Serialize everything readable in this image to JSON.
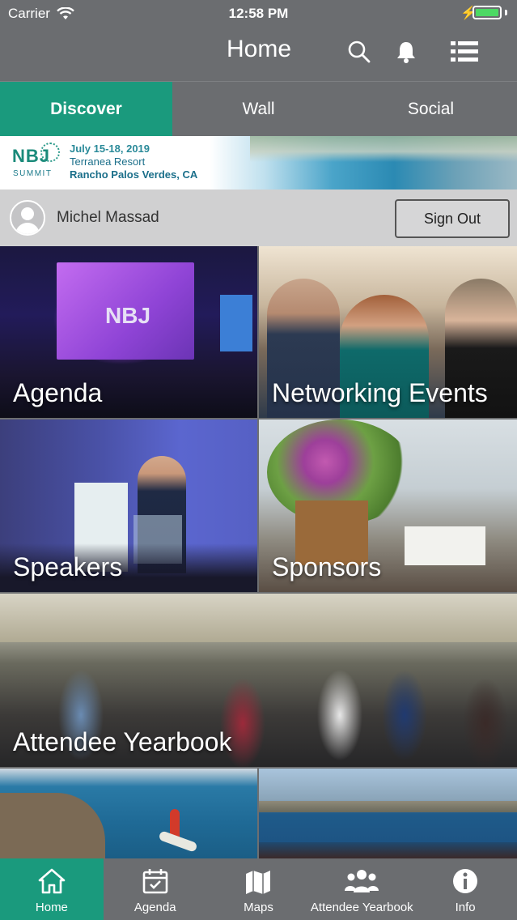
{
  "status_bar": {
    "carrier": "Carrier",
    "time": "12:58 PM"
  },
  "header": {
    "title": "Home",
    "icons": [
      "search-icon",
      "bell-icon",
      "list-icon"
    ]
  },
  "tabs": [
    {
      "label": "Discover",
      "active": true
    },
    {
      "label": "Wall",
      "active": false
    },
    {
      "label": "Social",
      "active": false
    }
  ],
  "banner": {
    "logo": "NBJ",
    "logo_sub": "SUMMIT",
    "dates": "July 15-18, 2019",
    "venue": "Terranea Resort",
    "location": "Rancho Palos Verdes, CA"
  },
  "user": {
    "name": "Michel Massad",
    "sign_out_label": "Sign Out"
  },
  "tiles": [
    {
      "label": "Agenda"
    },
    {
      "label": "Networking Events"
    },
    {
      "label": "Speakers"
    },
    {
      "label": "Sponsors"
    },
    {
      "label": "Attendee Yearbook"
    },
    {
      "label": ""
    },
    {
      "label": ""
    }
  ],
  "tabbar": [
    {
      "label": "Home",
      "icon": "home-icon",
      "active": true
    },
    {
      "label": "Agenda",
      "icon": "calendar-icon",
      "active": false
    },
    {
      "label": "Maps",
      "icon": "map-icon",
      "active": false
    },
    {
      "label": "Attendee Yearbook",
      "icon": "people-icon",
      "active": false
    },
    {
      "label": "Info",
      "icon": "info-icon",
      "active": false
    }
  ],
  "colors": {
    "accent": "#1a9a7d",
    "bar": "#6b6d70"
  }
}
